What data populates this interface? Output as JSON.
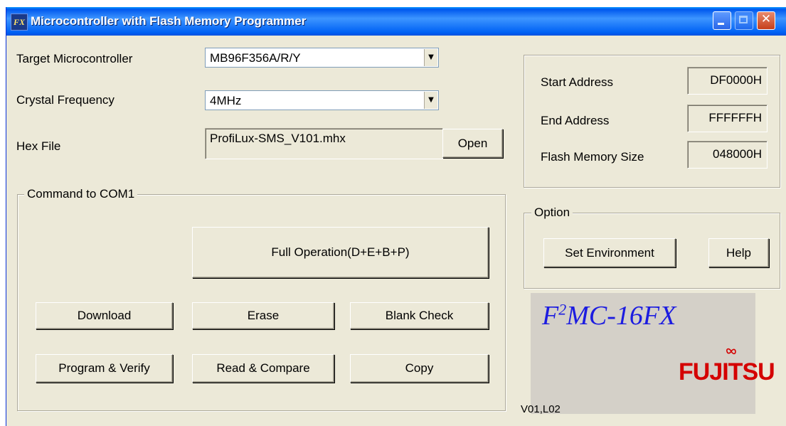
{
  "window": {
    "title": "Microcontroller with Flash Memory Programmer",
    "app_icon_text": "FX"
  },
  "form": {
    "target_label": "Target Microcontroller",
    "target_value": "MB96F356A/R/Y",
    "crystal_label": "Crystal Frequency",
    "crystal_value": "4MHz",
    "hex_label": "Hex File",
    "hex_value": "ProfiLux-SMS_V101.mhx",
    "open_button": "Open"
  },
  "address_panel": {
    "start_label": "Start Address",
    "start_value": "DF0000H",
    "end_label": "End Address",
    "end_value": "FFFFFFH",
    "size_label": "Flash Memory Size",
    "size_value": "048000H"
  },
  "command_group": {
    "label": "Command to COM1",
    "full_operation": "Full Operation(D+E+B+P)",
    "download": "Download",
    "erase": "Erase",
    "blank_check": "Blank Check",
    "program_verify": "Program & Verify",
    "read_compare": "Read & Compare",
    "copy": "Copy"
  },
  "option_group": {
    "label": "Option",
    "set_environment": "Set Environment",
    "help": "Help"
  },
  "logo": {
    "product_prefix": "F",
    "product_sup": "2",
    "product_suffix": "MC-16FX",
    "vendor": "FUJITSU"
  },
  "version": "V01,L02",
  "colors": {
    "title_bar": "#0058ee",
    "window_bg": "#ece9d8",
    "product_blue": "#1c1ce0",
    "vendor_red": "#d40000"
  }
}
